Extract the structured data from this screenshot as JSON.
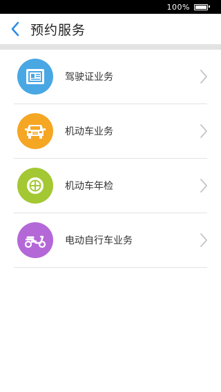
{
  "status_bar": {
    "battery_text": "100%"
  },
  "header": {
    "title": "预约服务"
  },
  "menu": {
    "items": [
      {
        "label": "驾驶证业务",
        "icon": "driver-license-icon",
        "color": "#49a7e4"
      },
      {
        "label": "机动车业务",
        "icon": "car-front-icon",
        "color": "#f5a623"
      },
      {
        "label": "机动车年检",
        "icon": "tire-icon",
        "color": "#a3c833"
      },
      {
        "label": "电动自行车业务",
        "icon": "scooter-icon",
        "color": "#b468d8"
      }
    ]
  },
  "colors": {
    "accent": "#2e8ce6",
    "divider": "#e3e3e3",
    "chevron": "#c8c8c8"
  }
}
